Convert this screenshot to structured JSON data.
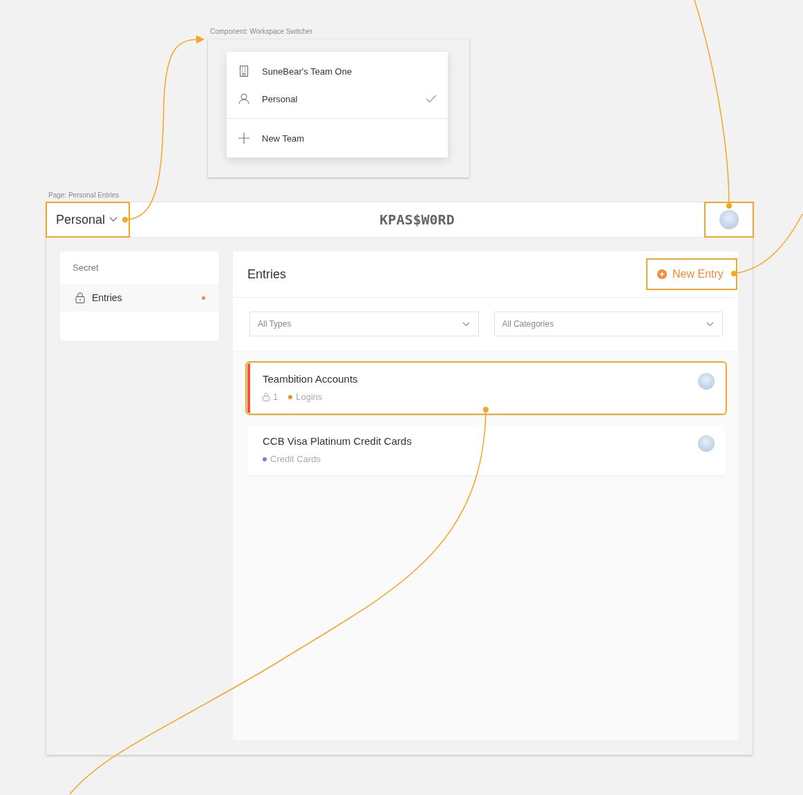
{
  "switcher": {
    "label": "Component: Workspace Switcher",
    "items": [
      {
        "kind": "team",
        "label": "SuneBear's Team One",
        "selected": false
      },
      {
        "kind": "personal",
        "label": "Personal",
        "selected": true
      }
    ],
    "action": {
      "label": "New Team"
    }
  },
  "page": {
    "label": "Page: Personal Entries",
    "workspace": "Personal",
    "logo": "KPAS$W0RD",
    "sidebar": {
      "heading": "Secret",
      "items": [
        {
          "label": "Entries",
          "selected": true
        }
      ]
    },
    "main": {
      "title": "Entries",
      "new_button": "New Entry",
      "filters": [
        {
          "value": "All Types"
        },
        {
          "value": "All Categories"
        }
      ],
      "entries": [
        {
          "title": "Teambition Accounts",
          "count": "1",
          "category": "Logins",
          "color": "#f5883a",
          "selected": true,
          "linked": true
        },
        {
          "title": "CCB Visa Platinum Credit Cards",
          "category": "Credit Cards",
          "color": "#7b7fd0",
          "selected": false,
          "linked": false
        }
      ]
    }
  }
}
